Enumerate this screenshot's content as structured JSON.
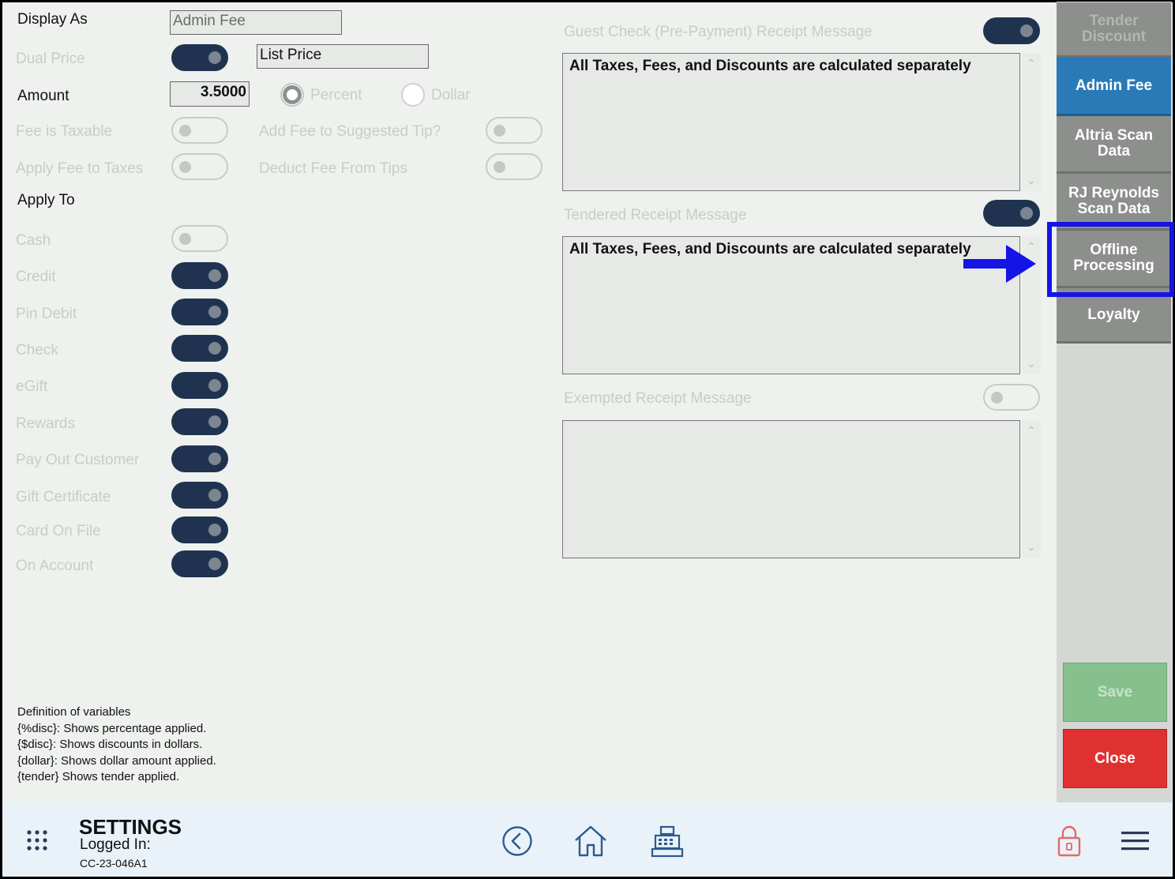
{
  "form": {
    "display_as_label": "Display As",
    "display_as_value": "Admin Fee",
    "dual_price_label": "Dual Price",
    "list_price_value": "List Price",
    "amount_label": "Amount",
    "amount_value": "3.5000",
    "percent_label": "Percent",
    "dollar_label": "Dollar",
    "fee_taxable_label": "Fee is Taxable",
    "add_fee_tip_label": "Add Fee to Suggested Tip?",
    "apply_fee_taxes_label": "Apply Fee to Taxes",
    "deduct_fee_tips_label": "Deduct Fee From Tips",
    "apply_to_label": "Apply To",
    "apply_to": [
      {
        "label": "Cash",
        "on": false
      },
      {
        "label": "Credit",
        "on": true
      },
      {
        "label": "Pin Debit",
        "on": true
      },
      {
        "label": "Check",
        "on": true
      },
      {
        "label": "eGift",
        "on": true
      },
      {
        "label": "Rewards",
        "on": true
      },
      {
        "label": "Pay Out Customer",
        "on": true
      },
      {
        "label": "Gift Certificate",
        "on": true
      },
      {
        "label": "Card On File",
        "on": true
      },
      {
        "label": "On Account",
        "on": true
      }
    ]
  },
  "receipts": {
    "guest_check_label": "Guest Check (Pre-Payment) Receipt Message",
    "guest_check_text": "All Taxes, Fees, and Discounts are calculated separately",
    "tendered_label": "Tendered Receipt Message",
    "tendered_text": "All Taxes, Fees, and Discounts are calculated separately",
    "exempted_label": "Exempted Receipt Message",
    "exempted_text": ""
  },
  "definitions": {
    "title": "Definition of variables",
    "lines": [
      "{%disc}: Shows percentage applied.",
      "{$disc}:  Shows discounts in dollars.",
      "{dollar}: Shows dollar amount applied.",
      "{tender} Shows tender applied."
    ]
  },
  "sidebar": {
    "tabs": [
      {
        "line1": "Tender",
        "line2": "Discount"
      },
      {
        "line1": "Admin Fee",
        "line2": ""
      },
      {
        "line1": "Altria Scan",
        "line2": "Data"
      },
      {
        "line1": "RJ Reynolds",
        "line2": "Scan Data"
      },
      {
        "line1": "Offline",
        "line2": "Processing"
      },
      {
        "line1": "Loyalty",
        "line2": ""
      }
    ],
    "save_label": "Save",
    "close_label": "Close"
  },
  "footer": {
    "title": "SETTINGS",
    "logged_in": "Logged In:",
    "device_id": "CC-23-046A1"
  },
  "colors": {
    "toggle_on": "#1f3350",
    "active_tab": "#2a7ab8",
    "save": "#86c08d",
    "close": "#e03131",
    "annotation": "#1414e6"
  }
}
